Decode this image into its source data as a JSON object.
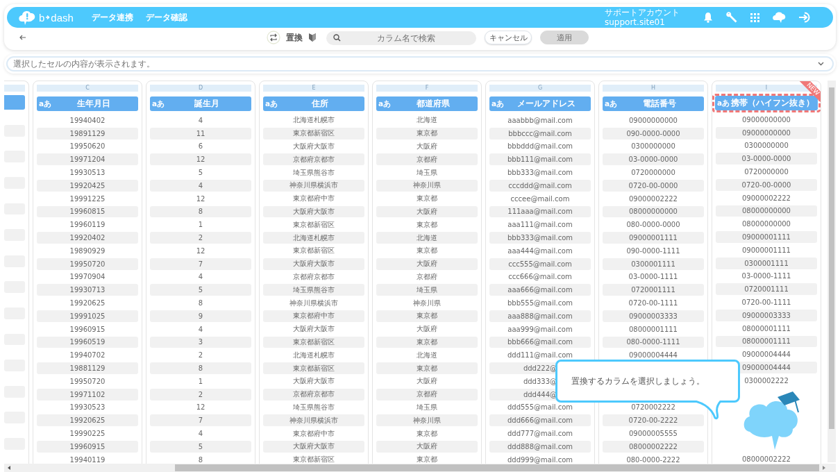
{
  "nav": {
    "logo": [
      "b",
      "dash"
    ],
    "items": [
      "データ連携",
      "データ確認"
    ],
    "account": {
      "name": "サポートアカウント",
      "id": "support.site01"
    }
  },
  "toolbar": {
    "mode": "置換",
    "search": {
      "placeholder": "カラム名で検索"
    },
    "buttons": [
      {
        "label": "キャンセル",
        "disabled": false
      },
      {
        "label": "適用",
        "disabled": true
      }
    ]
  },
  "cell_view": {
    "placeholder": "選択したセルの内容が表示されます。"
  },
  "columns": [
    {
      "kind": "cut"
    },
    {
      "kind": "full",
      "letter": "C",
      "type_badge": "aあ",
      "title": "生年月日",
      "selected": false
    },
    {
      "kind": "full",
      "letter": "D",
      "type_badge": "aあ",
      "title": "誕生月",
      "selected": false
    },
    {
      "kind": "full",
      "letter": "E",
      "type_badge": "aあ",
      "title": "住所",
      "selected": false
    },
    {
      "kind": "full",
      "letter": "F",
      "type_badge": "aあ",
      "title": "都道府県",
      "selected": false
    },
    {
      "kind": "full",
      "letter": "G",
      "type_badge": "aあ",
      "title": "メールアドレス",
      "selected": false
    },
    {
      "kind": "full",
      "letter": "H",
      "type_badge": "aあ",
      "title": "電話番号",
      "selected": false
    },
    {
      "kind": "full",
      "letter": "I",
      "type_badge": "aあ",
      "title": "携帯（ハイフン抜き）",
      "selected": true,
      "ribbon": "NEW"
    }
  ],
  "rows": [
    [
      "19940402",
      "4",
      "北海道札幌市",
      "北海道",
      "aaabbb@mail.com",
      "09000000000",
      "09000000000"
    ],
    [
      "19891129",
      "11",
      "東京都新宿区",
      "東京都",
      "bbbccc@mail.com",
      "090-0000-0000",
      "09000000000"
    ],
    [
      "19950620",
      "6",
      "大阪府大阪市",
      "大阪府",
      "bbbddd@mail.com",
      "0300000000",
      "0300000000"
    ],
    [
      "19971204",
      "12",
      "京都府京都市",
      "京都府",
      "bbb111@mail.com",
      "03-0000-0000",
      "03-0000-0000"
    ],
    [
      "19930513",
      "5",
      "埼玉県熊谷市",
      "埼玉県",
      "bbb333@mail.com",
      "0720000000",
      "0720000000"
    ],
    [
      "19920425",
      "4",
      "神奈川県横浜市",
      "神奈川県",
      "cccddd@mail.com",
      "0720-00-0000",
      "0720-00-0000"
    ],
    [
      "19991225",
      "12",
      "東京都府中市",
      "東京都",
      "cccee@mail.com",
      "09000002222",
      "09000002222"
    ],
    [
      "19960815",
      "8",
      "大阪府大阪市",
      "大阪府",
      "111aaa@mail.com",
      "08000000000",
      "08000000000"
    ],
    [
      "19960119",
      "1",
      "東京都新宿区",
      "東京都",
      "aaa111@mail.com",
      "080-0000-0000",
      "08000000000"
    ],
    [
      "19920402",
      "2",
      "北海道札幌市",
      "北海道",
      "bbb333@mail.com",
      "09000001111",
      "09000001111"
    ],
    [
      "19890929",
      "12",
      "東京都新宿区",
      "東京都",
      "aaa444@mail.com",
      "090-0000-1111",
      "09000001111"
    ],
    [
      "19950720",
      "7",
      "大阪府大阪市",
      "大阪府",
      "ccc555@mail.com",
      "0300001111",
      "0300001111"
    ],
    [
      "19970904",
      "4",
      "京都府京都市",
      "京都府",
      "ccc666@mail.com",
      "03-0000-1111",
      "03-0000-1111"
    ],
    [
      "19930713",
      "5",
      "埼玉県熊谷市",
      "埼玉県",
      "aaa666@mail.com",
      "0720001111",
      "0720001111"
    ],
    [
      "19920625",
      "8",
      "神奈川県横浜市",
      "神奈川県",
      "bbb555@mail.com",
      "0720-00-1111",
      "0720-00-1111"
    ],
    [
      "19991025",
      "9",
      "東京都府中市",
      "東京都",
      "aaa888@mail.com",
      "09000003333",
      "09000003333"
    ],
    [
      "19960915",
      "4",
      "大阪府大阪市",
      "大阪府",
      "aaa999@mail.com",
      "08000001111",
      "08000001111"
    ],
    [
      "19960519",
      "3",
      "東京都新宿区",
      "東京都",
      "bbb666@mail.com",
      "080-0000-1111",
      "08000001111"
    ],
    [
      "19940702",
      "2",
      "北海道札幌市",
      "北海道",
      "ddd111@mail.com",
      "09000004444",
      "09000004444"
    ],
    [
      "19881129",
      "8",
      "東京都新宿区",
      "東京都",
      "ddd222@",
      "",
      "09000004444"
    ],
    [
      "19950720",
      "1",
      "大阪府大阪市",
      "大阪府",
      "ddd333@",
      "",
      "0300002222"
    ],
    [
      "19971102",
      "2",
      "京都府京都市",
      "京都府",
      "ddd444@",
      "",
      ""
    ],
    [
      "19930523",
      "12",
      "埼玉県熊谷市",
      "埼玉県",
      "ddd555@mail.com",
      "0720002222",
      ""
    ],
    [
      "19920625",
      "7",
      "神奈川県横浜市",
      "神奈川県",
      "ddd666@mail.com",
      "0720-00-2222",
      ""
    ],
    [
      "19990225",
      "4",
      "東京都府中市",
      "東京都",
      "ddd777@mail.com",
      "09000005555",
      ""
    ],
    [
      "19960915",
      "5",
      "大阪府大阪市",
      "大阪府",
      "ddd888@mail.com",
      "08000002222",
      ""
    ],
    [
      "19940119",
      "8",
      "東京都新宿区",
      "東京都",
      "ddd999@mail.com",
      "080-0000-2222",
      "08000002222"
    ]
  ],
  "tip": {
    "text": "置換するカラムを選択しましょう。"
  }
}
